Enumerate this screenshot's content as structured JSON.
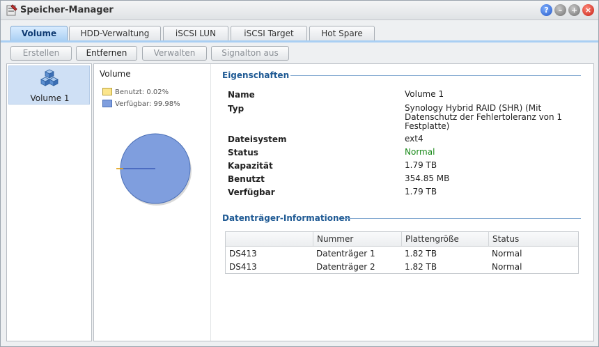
{
  "window": {
    "title": "Speicher-Manager"
  },
  "titlebar_buttons": {
    "help": "?",
    "minimize": "–",
    "maximize": "+",
    "close": "×"
  },
  "tabs": [
    {
      "label": "Volume",
      "active": true
    },
    {
      "label": "HDD-Verwaltung",
      "active": false
    },
    {
      "label": "iSCSI LUN",
      "active": false
    },
    {
      "label": "iSCSI Target",
      "active": false
    },
    {
      "label": "Hot Spare",
      "active": false
    }
  ],
  "toolbar": {
    "create": "Erstellen",
    "remove": "Entfernen",
    "manage": "Verwalten",
    "beep_off": "Signalton aus"
  },
  "volume_list": [
    {
      "label": "Volume 1",
      "icon": "cubes-icon"
    }
  ],
  "chart": {
    "title": "Volume",
    "legend": [
      {
        "label": "Benutzt: 0.02%",
        "color": "#fbe58c"
      },
      {
        "label": "Verfügbar: 99.98%",
        "color": "#7f9ede"
      }
    ],
    "chart_data": {
      "type": "pie",
      "categories": [
        "Benutzt",
        "Verfügbar"
      ],
      "values": [
        0.02,
        99.98
      ],
      "colors": [
        "#f0a500",
        "#7f9ede"
      ]
    }
  },
  "properties": {
    "title": "Eigenschaften",
    "rows": [
      {
        "key": "Name",
        "value": "Volume 1"
      },
      {
        "key": "Typ",
        "value": "Synology Hybrid RAID (SHR) (Mit Datenschutz der Fehlertoleranz von 1 Festplatte)"
      },
      {
        "key": "Dateisystem",
        "value": "ext4"
      },
      {
        "key": "Status",
        "value": "Normal"
      },
      {
        "key": "Kapazität",
        "value": "1.79 TB"
      },
      {
        "key": "Benutzt",
        "value": "354.85 MB"
      },
      {
        "key": "Verfügbar",
        "value": "1.79 TB"
      }
    ]
  },
  "disk_info": {
    "title": "Datenträger-Informationen",
    "columns": [
      "",
      "Nummer",
      "Plattengröße",
      "Status"
    ],
    "rows": [
      {
        "device": "DS413",
        "number": "Datenträger 1",
        "size": "1.82 TB",
        "status": "Normal"
      },
      {
        "device": "DS413",
        "number": "Datenträger 2",
        "size": "1.82 TB",
        "status": "Normal"
      }
    ]
  },
  "colors": {
    "accent": "#1f5a94",
    "status_ok": "#1a8a1a"
  }
}
